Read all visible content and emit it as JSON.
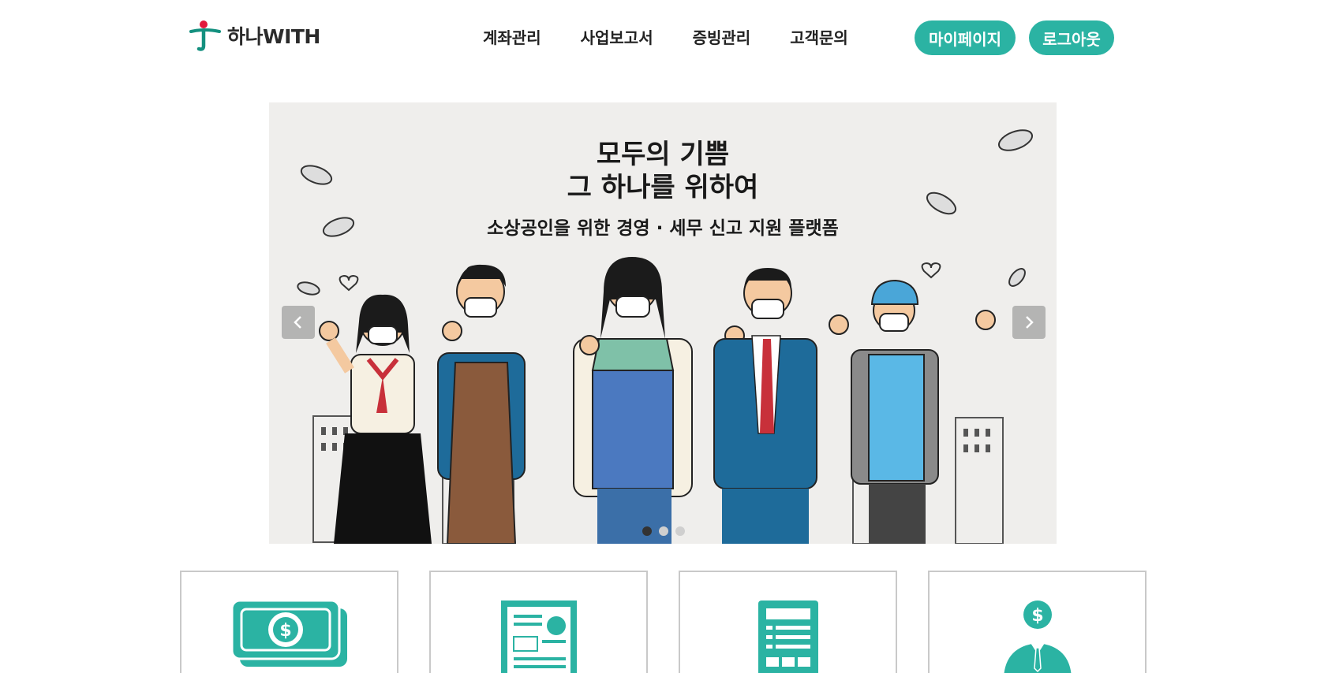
{
  "header": {
    "logo_text": "하나WITH",
    "nav": [
      "계좌관리",
      "사업보고서",
      "증빙관리",
      "고객문의"
    ],
    "mypage_label": "마이페이지",
    "logout_label": "로그아웃"
  },
  "banner": {
    "title_line1": "모두의 기쁨",
    "title_line2": "그 하나를 위하여",
    "subtitle": "소상공인을 위한 경영 · 세무 신고 지원 플랫폼",
    "slide_count": 3,
    "active_slide": 1
  },
  "cards": [
    {
      "icon": "money-icon"
    },
    {
      "icon": "report-icon"
    },
    {
      "icon": "receipt-icon"
    },
    {
      "icon": "consultant-icon"
    }
  ],
  "colors": {
    "accent": "#2bb3a3",
    "banner_bg": "#efeeec"
  }
}
